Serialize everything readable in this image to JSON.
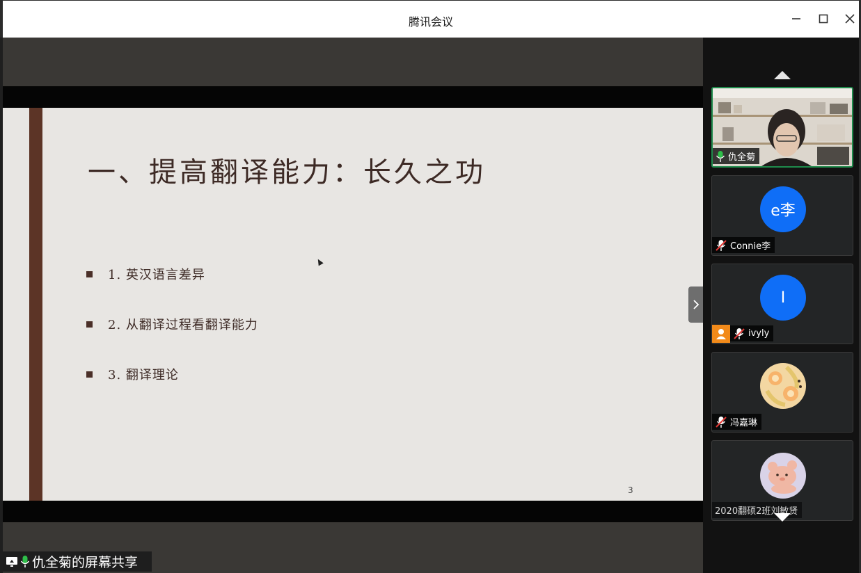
{
  "window": {
    "title": "腾讯会议",
    "minimize_label": "Minimize",
    "maximize_label": "Maximize",
    "close_label": "Close"
  },
  "slide": {
    "heading": "一、提高翻译能力：长久之功",
    "bullets": [
      "1. 英汉语言差异",
      "2. 从翻译过程看翻译能力",
      "3. 翻译理论"
    ],
    "page_number": "3",
    "bar_color": "#5c3426"
  },
  "share_label": {
    "text": "仇全菊的屏幕共享",
    "icons": [
      "screen-share-icon",
      "mic-on-icon"
    ]
  },
  "participants": [
    {
      "name": "仇全菊",
      "mic": "on",
      "video": true,
      "active_speaker": true
    },
    {
      "name": "Connie李",
      "avatar_text": "e李",
      "mic": "muted",
      "avatar_color": "#0f6ef7"
    },
    {
      "name": "ivyly",
      "avatar_text": "I",
      "mic": "muted",
      "avatar_color": "#0f6ef7",
      "host_badge": true
    },
    {
      "name": "冯嘉琳",
      "mic": "muted",
      "avatar_image": "fruit-slices"
    },
    {
      "name": "2020翻硕2班刘敏贤",
      "mic": "none",
      "avatar_image": "bear"
    }
  ],
  "colors": {
    "accent_green": "#1f8b4c",
    "avatar_blue": "#0f6ef7",
    "host_orange": "#f28a1a"
  }
}
